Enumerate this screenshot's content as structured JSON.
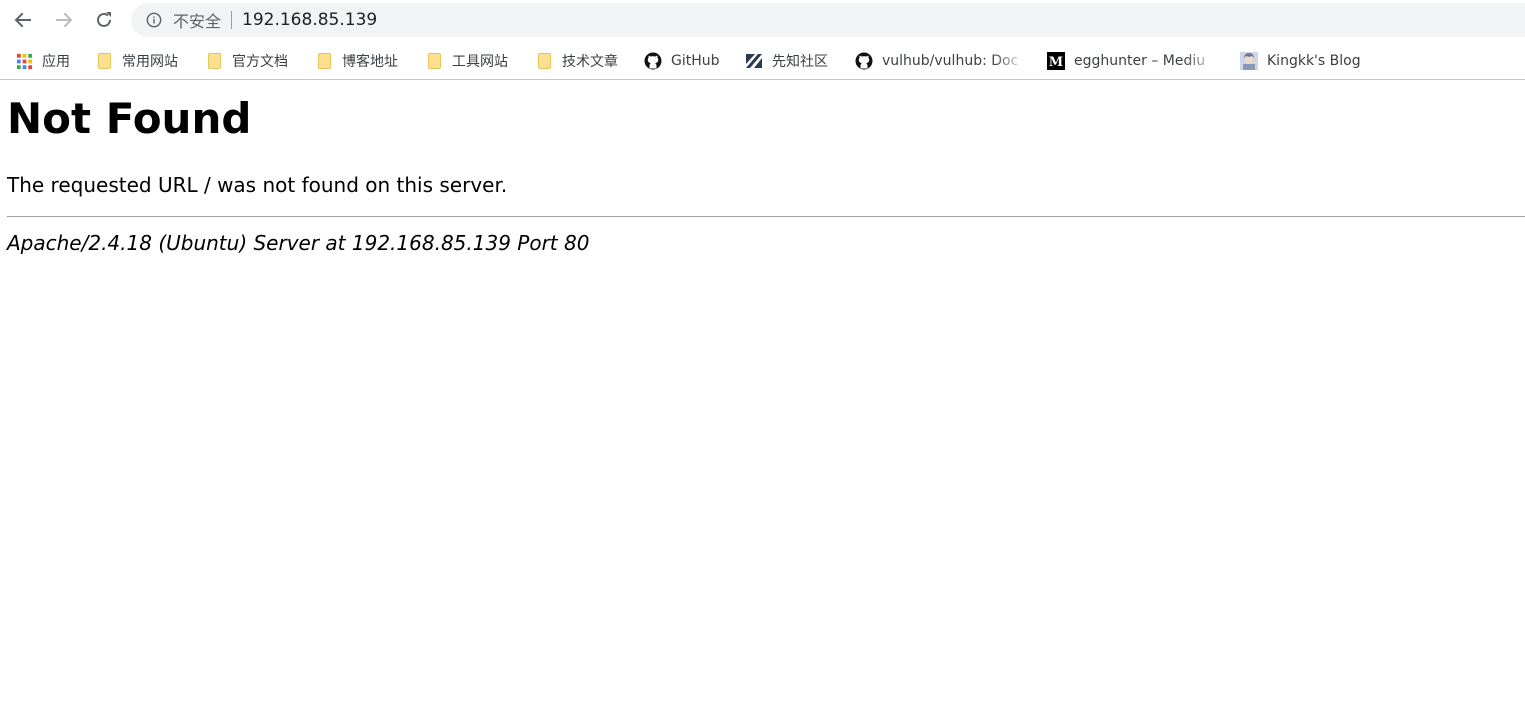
{
  "browser": {
    "security_label": "不安全",
    "url": "192.168.85.139"
  },
  "bookmarks": [
    {
      "label": "应用",
      "icon": "apps-grid-icon"
    },
    {
      "label": "常用网站",
      "icon": "folder-icon"
    },
    {
      "label": "官方文档",
      "icon": "folder-icon"
    },
    {
      "label": "博客地址",
      "icon": "folder-icon"
    },
    {
      "label": "工具网站",
      "icon": "folder-icon"
    },
    {
      "label": "技术文章",
      "icon": "folder-icon"
    },
    {
      "label": "GitHub",
      "icon": "github-icon"
    },
    {
      "label": "先知社区",
      "icon": "xianzhi-icon"
    },
    {
      "label": "vulhub/vulhub: Doc",
      "icon": "github-icon"
    },
    {
      "label": "egghunter – Mediu",
      "icon": "medium-icon"
    },
    {
      "label": "Kingkk's Blog",
      "icon": "avatar-icon"
    }
  ],
  "page": {
    "title": "Not Found",
    "message": "The requested URL / was not found on this server.",
    "server_signature": "Apache/2.4.18 (Ubuntu) Server at 192.168.85.139 Port 80"
  }
}
